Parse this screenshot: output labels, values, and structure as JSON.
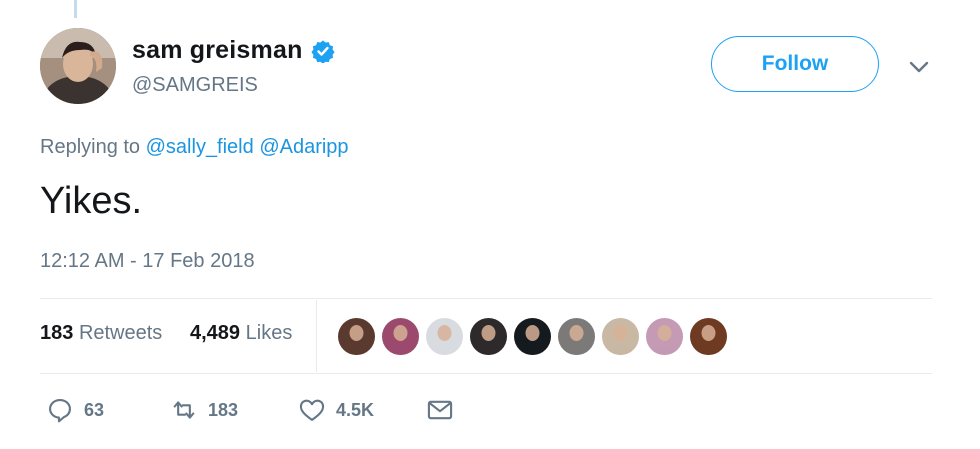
{
  "user": {
    "display_name": "sam greisman",
    "handle": "@SAMGREIS",
    "avatar_icon": "profile-photo",
    "verified_icon": "verified-badge-icon"
  },
  "follow_button": {
    "label": "Follow"
  },
  "more_menu": {
    "icon": "chevron-down-icon"
  },
  "reply_context": {
    "prefix": "Replying to",
    "mentions": [
      "@sally_field",
      "@Adaripp"
    ]
  },
  "tweet": {
    "text": "Yikes.",
    "timestamp": "12:12 AM - 17 Feb 2018"
  },
  "stats": {
    "retweets_count": "183",
    "retweets_label": "Retweets",
    "likes_count": "4,489",
    "likes_label": "Likes",
    "likers": [
      {
        "color": "#5a3a2e"
      },
      {
        "color": "#9b4a6e"
      },
      {
        "color": "#d8dce0"
      },
      {
        "color": "#2e2a2c"
      },
      {
        "color": "#141a1e"
      },
      {
        "color": "#7c7a78"
      },
      {
        "color": "#c8b8a4"
      },
      {
        "color": "#c49ab4"
      },
      {
        "color": "#6e3a22"
      }
    ]
  },
  "actions": {
    "reply": {
      "icon": "reply-icon",
      "count": "63"
    },
    "retweet": {
      "icon": "retweet-icon",
      "count": "183"
    },
    "like": {
      "icon": "heart-icon",
      "count": "4.5K"
    },
    "dm": {
      "icon": "envelope-icon"
    }
  },
  "colors": {
    "accent": "#1da1f2",
    "link": "#1b95e0",
    "muted": "#657786",
    "text": "#14171a"
  }
}
